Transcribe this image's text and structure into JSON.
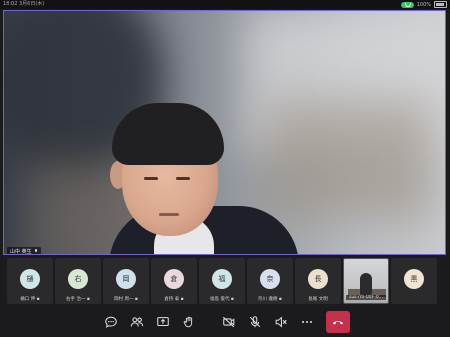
{
  "status_bar": {
    "time": "18:02  3月6日(木)",
    "battery": "100%"
  },
  "main_video": {
    "speaker_name": "山中 英生"
  },
  "gallery": [
    {
      "avatar": "樋",
      "name": "樋口 伸 ▪",
      "color": "#cfe7e7"
    },
    {
      "avatar": "右",
      "name": "右手 治一 ▪",
      "color": "#d7e8d1"
    },
    {
      "avatar": "岡",
      "name": "岡村 周一 ▪",
      "color": "#cde2ee"
    },
    {
      "avatar": "倉",
      "name": "倉持 泰 ▪",
      "color": "#ecd7df"
    },
    {
      "avatar": "福",
      "name": "福島 俊代 ▪",
      "color": "#cfe6e6"
    },
    {
      "avatar": "奈",
      "name": "奈川 雅樹 ▪",
      "color": "#d8dff0"
    },
    {
      "avatar": "長",
      "name": "長尾 文明",
      "color": "#ece0cc"
    },
    {
      "avatar": "",
      "name": "sus-rm-00F-0...",
      "video": true
    },
    {
      "avatar": "黒",
      "name": "",
      "color": "#f3e3d3"
    }
  ],
  "toolbar": {
    "buttons": [
      "chat",
      "participants",
      "share",
      "raise-hand",
      "camera-off",
      "mic-off",
      "speaker-off",
      "more"
    ],
    "end_call_color": "#c4314b"
  }
}
